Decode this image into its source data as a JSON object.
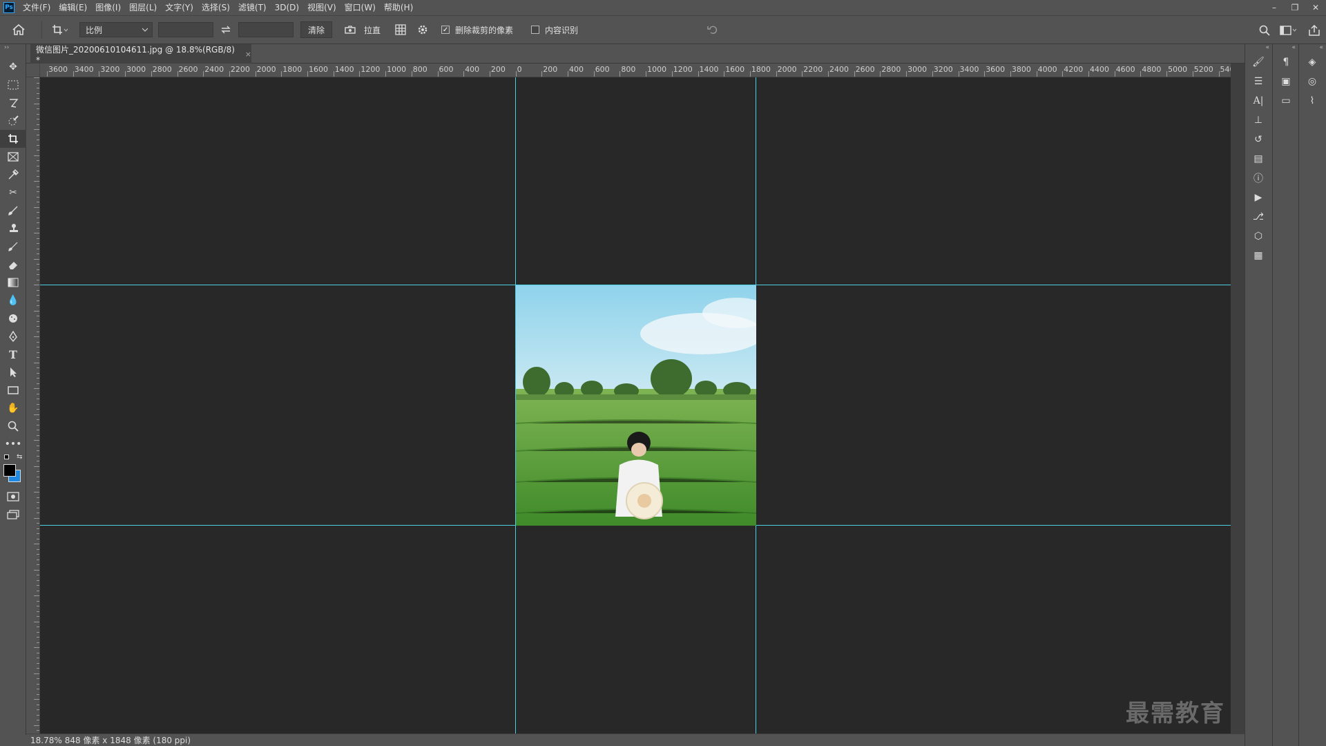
{
  "menubar": {
    "logo": "Ps",
    "items": [
      "文件(F)",
      "编辑(E)",
      "图像(I)",
      "图层(L)",
      "文字(Y)",
      "选择(S)",
      "滤镜(T)",
      "3D(D)",
      "视图(V)",
      "窗口(W)",
      "帮助(H)"
    ],
    "window_controls": [
      "–",
      "❐",
      "✕"
    ]
  },
  "options": {
    "ratio_select": "比例",
    "width_value": "",
    "height_value": "",
    "swap_icon": "swap-icon",
    "clear_label": "清除",
    "straighten_label": "拉直",
    "delete_cropped": {
      "label": "删除裁剪的像素",
      "checked": true
    },
    "content_aware": {
      "label": "内容识别",
      "checked": false
    }
  },
  "document": {
    "tab_label": "微信图片_20200610104611.jpg @ 18.8%(RGB/8) *",
    "close_symbol": "×"
  },
  "ruler": {
    "horizontal_labels": [
      "3600",
      "3400",
      "3200",
      "3000",
      "2800",
      "2600",
      "2400",
      "2200",
      "2000",
      "1800",
      "1600",
      "1400",
      "1200",
      "1000",
      "800",
      "600",
      "400",
      "200",
      "0",
      "200",
      "400",
      "600",
      "800",
      "1000",
      "1200",
      "1400",
      "1600",
      "1800",
      "2000",
      "2200",
      "2400",
      "2600",
      "2800",
      "3000",
      "3200",
      "3400",
      "3600",
      "3800",
      "4000",
      "4200",
      "4400",
      "4600",
      "4800",
      "5000",
      "5200",
      "540"
    ]
  },
  "status": {
    "zoom": "18.78%",
    "info": "848 像素 x 1848 像素 (180 ppi)"
  },
  "watermark": "最需教育",
  "colors": {
    "ui_bg": "#535353",
    "canvas_bg": "#282828",
    "guide": "#4dd0e1",
    "foreground": "#000000",
    "background": "#1e88e5"
  }
}
